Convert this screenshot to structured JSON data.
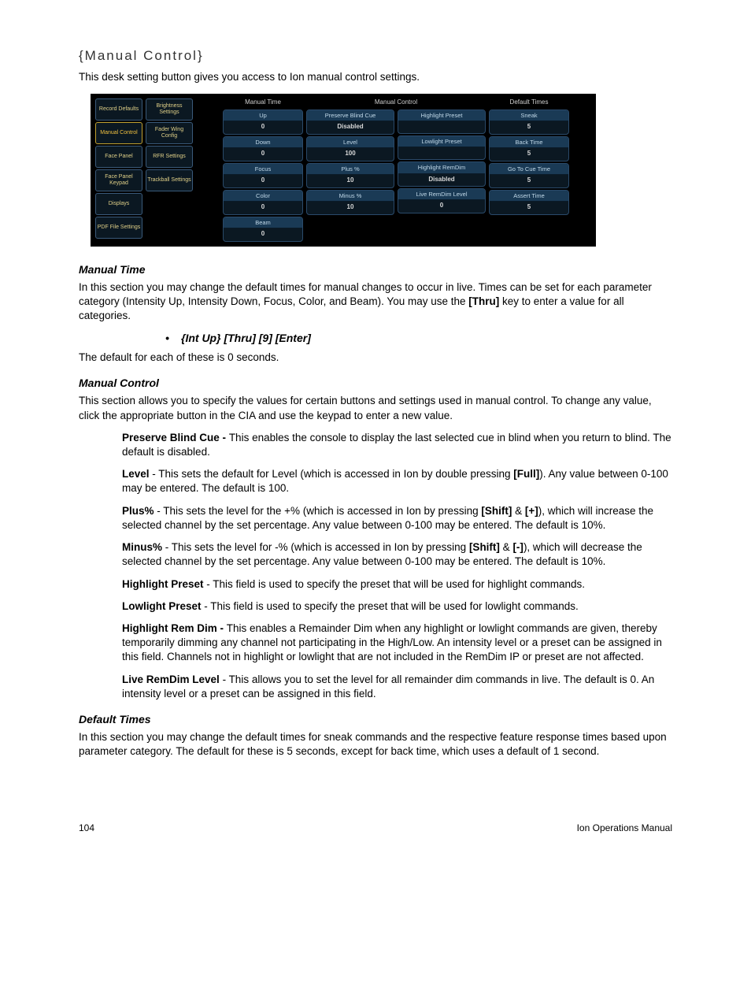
{
  "title": "{Manual Control}",
  "intro": "This desk setting button gives you access to Ion manual control settings.",
  "tabsL": [
    "Record Defaults",
    "Manual Control",
    "Face Panel",
    "Face Panel Keypad",
    "Displays",
    "PDF File Settings"
  ],
  "tabsR": [
    "Brightness Settings",
    "Fader Wing Config",
    "RFR Settings",
    "Trackball Settings"
  ],
  "colheads": {
    "mt": "Manual Time",
    "mc": "Manual Control",
    "dt": "Default Times"
  },
  "mt": [
    {
      "l": "Up",
      "v": "0"
    },
    {
      "l": "Down",
      "v": "0"
    },
    {
      "l": "Focus",
      "v": "0"
    },
    {
      "l": "Color",
      "v": "0"
    },
    {
      "l": "Beam",
      "v": "0"
    }
  ],
  "mc1": [
    {
      "l": "Preserve Blind Cue",
      "v": "Disabled"
    },
    {
      "l": "Level",
      "v": "100"
    },
    {
      "l": "Plus %",
      "v": "10"
    },
    {
      "l": "Minus %",
      "v": "10"
    }
  ],
  "mc2": [
    {
      "l": "Highlight Preset",
      "v": ""
    },
    {
      "l": "Lowlight Preset",
      "v": ""
    },
    {
      "l": "Highlight RemDim",
      "v": "Disabled"
    },
    {
      "l": "Live RemDim Level",
      "v": "0"
    }
  ],
  "dt": [
    {
      "l": "Sneak",
      "v": "5"
    },
    {
      "l": "Back Time",
      "v": "5"
    },
    {
      "l": "Go To Cue Time",
      "v": "5"
    },
    {
      "l": "Assert Time",
      "v": "5"
    }
  ],
  "sec_mt_h": "Manual Time",
  "sec_mt_p": "In this section you may change the default times for manual changes to occur in live. Times can be set for each parameter category (Intensity Up, Intensity Down, Focus, Color, and Beam). You may use the [Thru] key to enter a value for all categories.",
  "bullet1": "{Int Up} [Thru] [9] [Enter]",
  "sec_mt_p2": "The default for each of these is 0 seconds.",
  "sec_mc_h": "Manual Control",
  "sec_mc_p": "This section allows you to specify the values for certain buttons and settings used in manual control. To change any value, click the appropriate button in the CIA and use the keypad to enter a new value.",
  "defs": [
    {
      "b": "Preserve Blind Cue - ",
      "t": "This enables the console to display the last selected cue in blind when you return to blind. The default is disabled."
    },
    {
      "b": "Level",
      "t": " - This sets the default for Level (which is accessed in Ion by double pressing [Full]). Any value between 0-100 may be entered. The default is 100."
    },
    {
      "b": "Plus%",
      "t": " - This sets the level for the +% (which is accessed in Ion by pressing [Shift] & [+]), which will increase the selected channel by the set percentage. Any value between 0-100 may be entered. The default is 10%."
    },
    {
      "b": "Minus%",
      "t": " - This sets the level for -% (which is accessed in Ion by pressing [Shift] & [-]), which will decrease the selected channel by the set percentage. Any value between 0-100 may be entered. The default is 10%."
    },
    {
      "b": "Highlight Preset",
      "t": " - This field is used to specify the preset that will be used for highlight commands."
    },
    {
      "b": "Lowlight Preset",
      "t": " - This field is used to specify the preset that will be used for lowlight commands."
    },
    {
      "b": "Highlight Rem Dim - ",
      "t": "This enables a Remainder Dim when any highlight or lowlight commands are given, thereby temporarily dimming any channel not participating in the High/Low. An intensity level or a preset can be assigned in this field. Channels not in highlight or lowlight that are not included in the RemDim IP or preset are not affected."
    },
    {
      "b": "Live RemDim Level",
      "t": " - This allows you to set the level for all remainder dim commands in live. The default is 0. An intensity level or a preset can be assigned in this field."
    }
  ],
  "sec_dt_h": "Default Times",
  "sec_dt_p": "In this section you may change the default times for sneak commands and the respective feature response times based upon parameter category. The default for these is 5 seconds, except for back time, which uses a default of 1 second.",
  "footer_l": "104",
  "footer_r": "Ion Operations Manual"
}
